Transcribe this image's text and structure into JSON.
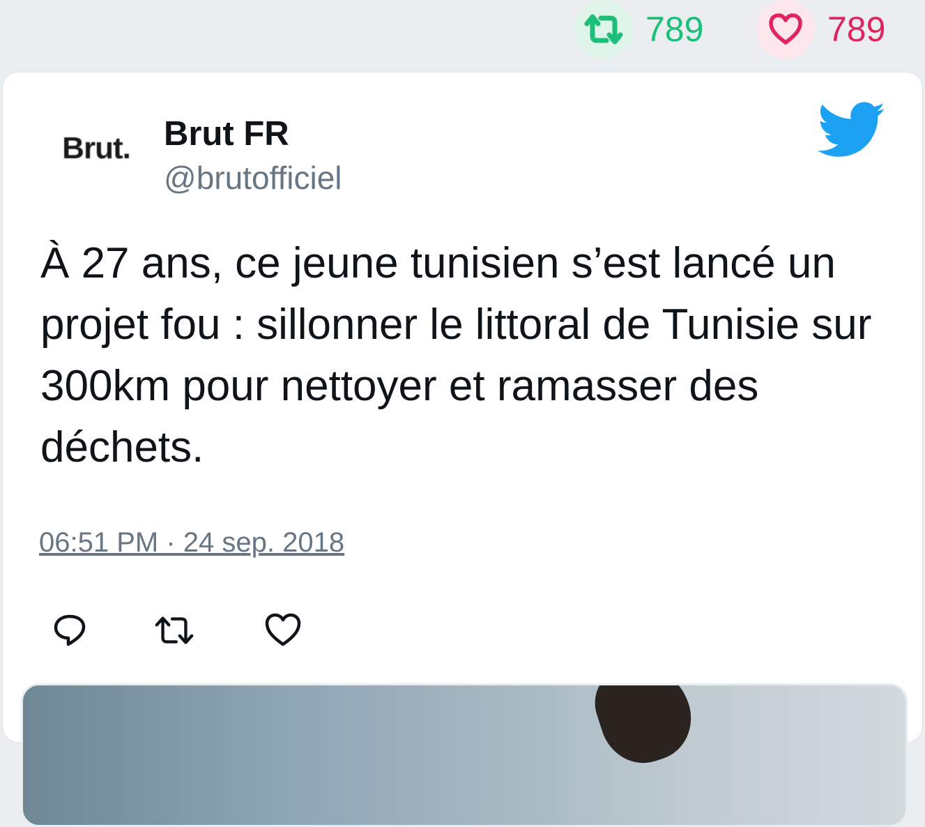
{
  "stats": {
    "retweet_count": "789",
    "like_count": "789",
    "retweet_color": "#1bbf7a",
    "like_color": "#e0245e"
  },
  "tweet": {
    "author_name": "Brut FR",
    "author_handle": "@brutofficiel",
    "avatar_text": "Brut.",
    "text": "À 27 ans, ce jeune tunisien s’est lancé un projet fou : sillonner le littoral de Tunisie sur 300km pour nettoyer et ramasser des déchets.",
    "timestamp": "06:51 PM · 24 sep. 2018",
    "brand_icon": "twitter-bird-icon",
    "brand_color": "#1da1f2"
  },
  "actions": {
    "reply_icon": "reply-icon",
    "retweet_icon": "retweet-icon",
    "like_icon": "heart-icon"
  }
}
